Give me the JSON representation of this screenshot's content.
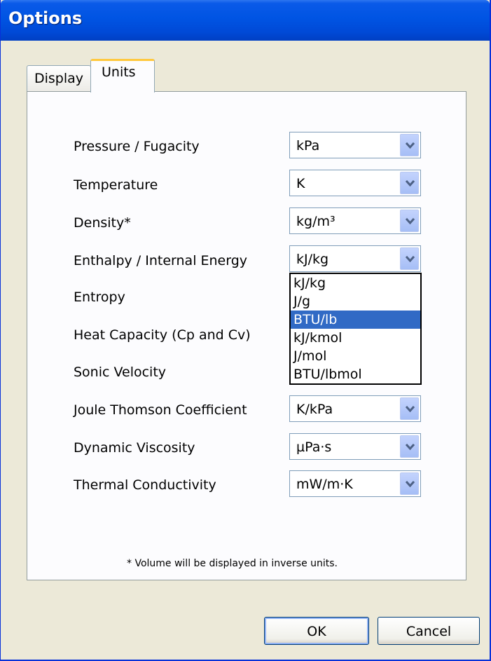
{
  "window": {
    "title": "Options"
  },
  "tabs": [
    {
      "label": "Display",
      "active": false
    },
    {
      "label": "Units",
      "active": true
    }
  ],
  "settings": [
    {
      "label": "Pressure / Fugacity",
      "value": "kPa"
    },
    {
      "label": "Temperature",
      "value": "K"
    },
    {
      "label": "Density*",
      "value": "kg/m³"
    },
    {
      "label": "Enthalpy / Internal Energy",
      "value": "kJ/kg"
    },
    {
      "label": "Entropy",
      "value": ""
    },
    {
      "label": "Heat Capacity (Cp and Cv)",
      "value": ""
    },
    {
      "label": "Sonic Velocity",
      "value": ""
    },
    {
      "label": "Joule Thomson Coefficient",
      "value": "K/kPa"
    },
    {
      "label": "Dynamic Viscosity",
      "value": "µPa·s"
    },
    {
      "label": "Thermal Conductivity",
      "value": "mW/m·K"
    }
  ],
  "dropdown": {
    "options": [
      "kJ/kg",
      "J/g",
      "BTU/lb",
      "kJ/kmol",
      "J/mol",
      "BTU/lbmol"
    ],
    "highlighted": "BTU/lb"
  },
  "note": "* Volume will be displayed in inverse units.",
  "buttons": {
    "ok": "OK",
    "cancel": "Cancel"
  },
  "colors": {
    "titlebar": "#0054e3",
    "selection": "#316ac5",
    "dialog": "#ece9d8"
  }
}
